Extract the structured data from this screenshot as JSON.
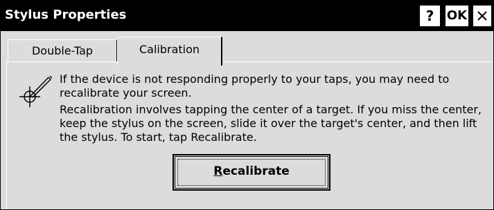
{
  "window": {
    "title": "Stylus Properties",
    "help_label": "?",
    "ok_label": "OK",
    "close_icon": "close-icon"
  },
  "tabs": [
    {
      "label": "Double-Tap",
      "selected": false
    },
    {
      "label": "Calibration",
      "selected": true
    }
  ],
  "calibration": {
    "icon": "stylus-crosshair-icon",
    "message_1": "If the device is not responding properly to your taps, you may need to recalibrate your screen.",
    "message_2": "Recalibration involves tapping the center of a target. If you miss the center, keep the stylus on the screen, slide it over the target's center, and then lift the stylus. To start, tap Recalibrate.",
    "button_label_first": "R",
    "button_label_rest": "ecalibrate"
  }
}
